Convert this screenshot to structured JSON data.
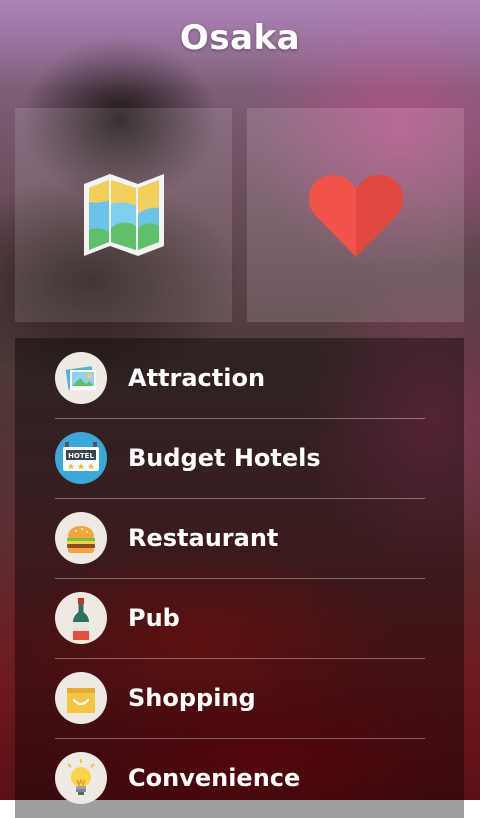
{
  "header": {
    "title": "Osaka"
  },
  "tiles": [
    {
      "icon": "map-icon"
    },
    {
      "icon": "heart-icon"
    }
  ],
  "menu": {
    "items": [
      {
        "label": "Attraction",
        "icon": "photo-icon"
      },
      {
        "label": "Budget Hotels",
        "icon": "hotel-sign-icon"
      },
      {
        "label": "Restaurant",
        "icon": "burger-icon"
      },
      {
        "label": "Pub",
        "icon": "wine-bottle-icon"
      },
      {
        "label": "Shopping",
        "icon": "shopping-bag-icon"
      },
      {
        "label": "Convenience",
        "icon": "lightbulb-icon"
      }
    ]
  },
  "colors": {
    "heart": "#f1524a",
    "hotel_circle": "#39a9d9",
    "shopping_bag": "#f4c542"
  }
}
